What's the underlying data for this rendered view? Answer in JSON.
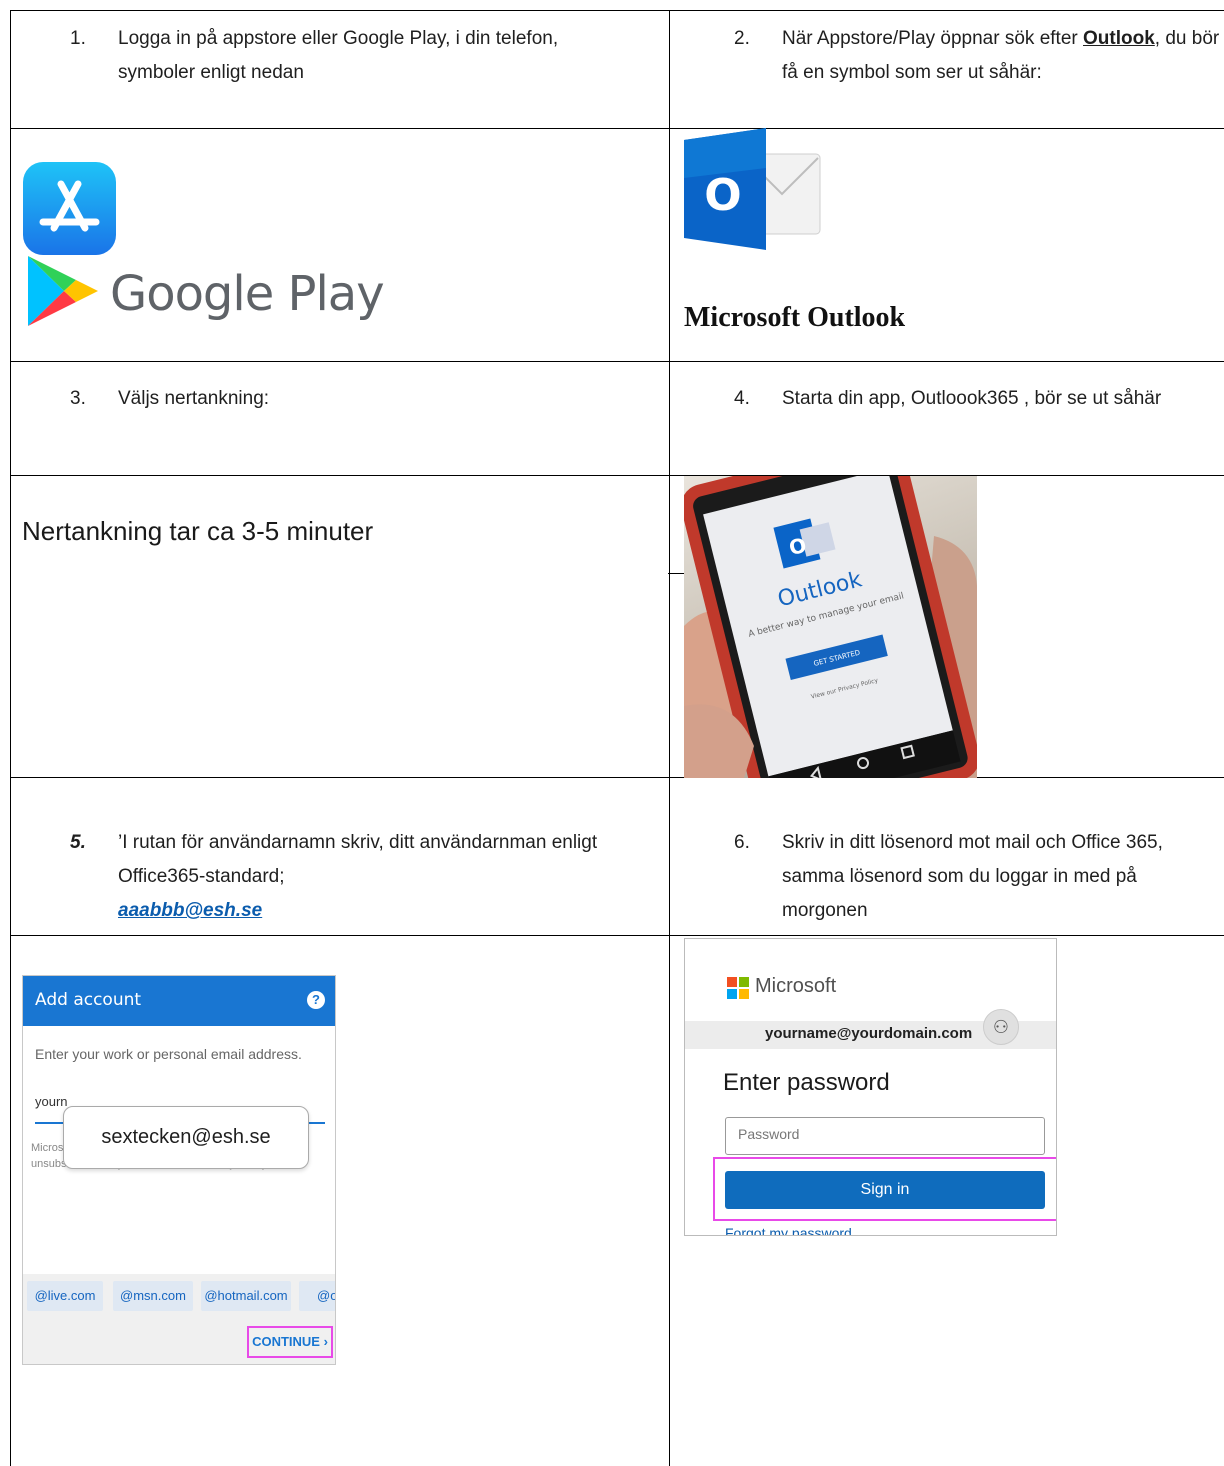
{
  "steps": {
    "s1": {
      "num": "1.",
      "text": "Logga in på appstore eller Google Play,  i din telefon, symboler enligt nedan"
    },
    "s2": {
      "num": "2.",
      "text_before": "När Appstore/Play öppnar sök efter ",
      "link": "Outlook",
      "text_after": ", du bör få en symbol som ser ut såhär:"
    },
    "s3": {
      "num": "3.",
      "text": "Väljs nertankning:"
    },
    "s4": {
      "num": "4.",
      "text": "Starta din app, Outloook365 , bör se ut såhär"
    },
    "s5": {
      "num": "5.",
      "text": "’I rutan för användarnamn skriv, ditt användarnman enligt Office365-standard;",
      "email": "aaabbb@esh.se"
    },
    "s6": {
      "num": "6.",
      "text": "Skriv in ditt lösenord mot mail och Office 365, samma lösenord som du loggar in med på morgonen"
    }
  },
  "google_play": "Google Play",
  "ms_outlook": "Microsoft Outlook",
  "nertankning": "Nertankning tar ca 3-5 minuter",
  "phone": {
    "app_name": "Outlook",
    "tagline": "A better way to manage your email",
    "button": "GET STARTED",
    "privacy": "View our Privacy Policy"
  },
  "add_account": {
    "title": "Add account",
    "help": "?",
    "prompt": "Enter your work or personal email address.",
    "input_partial": "yourn",
    "small1": "Micros",
    "small2": "unsubscribe at any time. View our Privacy Policy.",
    "bubble": "sextecken@esh.se",
    "chips": [
      "@live.com",
      "@msn.com",
      "@hotmail.com",
      "@ou"
    ],
    "continue": "CONTINUE ›"
  },
  "ms_signin": {
    "brand": "Microsoft",
    "email": "yourname@yourdomain.com",
    "enter_password": "Enter password",
    "password_placeholder": "Password",
    "sign_in": "Sign in",
    "forgot": "Forgot my password"
  }
}
